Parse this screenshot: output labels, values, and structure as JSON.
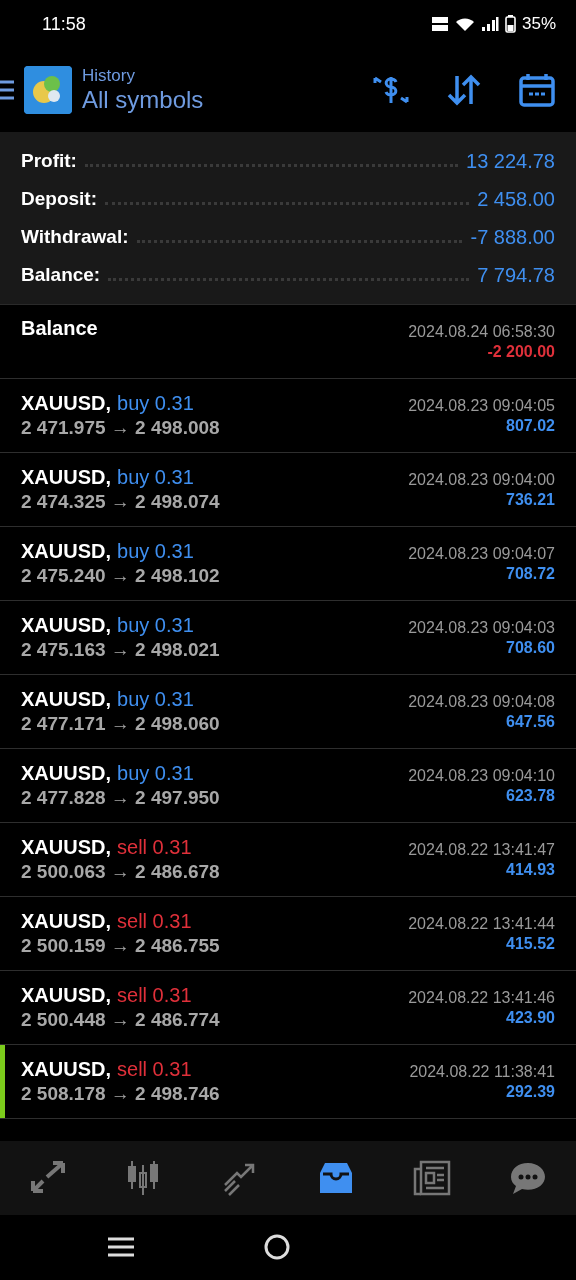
{
  "status_bar": {
    "time": "11:58",
    "battery": "35%"
  },
  "header": {
    "title": "History",
    "subtitle": "All symbols"
  },
  "summary": [
    {
      "label": "Profit:",
      "value": "13 224.78"
    },
    {
      "label": "Deposit:",
      "value": "2 458.00"
    },
    {
      "label": "Withdrawal:",
      "value": "-7 888.00"
    },
    {
      "label": "Balance:",
      "value": "7 794.78"
    }
  ],
  "rows": [
    {
      "kind": "balance",
      "title": "Balance",
      "time": "2024.08.24 06:58:30",
      "amount": "-2 200.00",
      "negative": true,
      "highlighted": false
    },
    {
      "kind": "trade",
      "symbol": "XAUUSD,",
      "side": "buy",
      "volume": "0.31",
      "prices": "2 471.975 → 2 498.008",
      "time": "2024.08.23 09:04:05",
      "amount": "807.02",
      "negative": false,
      "highlighted": false
    },
    {
      "kind": "trade",
      "symbol": "XAUUSD,",
      "side": "buy",
      "volume": "0.31",
      "prices": "2 474.325 → 2 498.074",
      "time": "2024.08.23 09:04:00",
      "amount": "736.21",
      "negative": false,
      "highlighted": false
    },
    {
      "kind": "trade",
      "symbol": "XAUUSD,",
      "side": "buy",
      "volume": "0.31",
      "prices": "2 475.240 → 2 498.102",
      "time": "2024.08.23 09:04:07",
      "amount": "708.72",
      "negative": false,
      "highlighted": false
    },
    {
      "kind": "trade",
      "symbol": "XAUUSD,",
      "side": "buy",
      "volume": "0.31",
      "prices": "2 475.163 → 2 498.021",
      "time": "2024.08.23 09:04:03",
      "amount": "708.60",
      "negative": false,
      "highlighted": false
    },
    {
      "kind": "trade",
      "symbol": "XAUUSD,",
      "side": "buy",
      "volume": "0.31",
      "prices": "2 477.171 → 2 498.060",
      "time": "2024.08.23 09:04:08",
      "amount": "647.56",
      "negative": false,
      "highlighted": false
    },
    {
      "kind": "trade",
      "symbol": "XAUUSD,",
      "side": "buy",
      "volume": "0.31",
      "prices": "2 477.828 → 2 497.950",
      "time": "2024.08.23 09:04:10",
      "amount": "623.78",
      "negative": false,
      "highlighted": false
    },
    {
      "kind": "trade",
      "symbol": "XAUUSD,",
      "side": "sell",
      "volume": "0.31",
      "prices": "2 500.063 → 2 486.678",
      "time": "2024.08.22 13:41:47",
      "amount": "414.93",
      "negative": false,
      "highlighted": false
    },
    {
      "kind": "trade",
      "symbol": "XAUUSD,",
      "side": "sell",
      "volume": "0.31",
      "prices": "2 500.159 → 2 486.755",
      "time": "2024.08.22 13:41:44",
      "amount": "415.52",
      "negative": false,
      "highlighted": false
    },
    {
      "kind": "trade",
      "symbol": "XAUUSD,",
      "side": "sell",
      "volume": "0.31",
      "prices": "2 500.448 → 2 486.774",
      "time": "2024.08.22 13:41:46",
      "amount": "423.90",
      "negative": false,
      "highlighted": false
    },
    {
      "kind": "trade",
      "symbol": "XAUUSD,",
      "side": "sell",
      "volume": "0.31",
      "prices": "2 508.178 → 2 498.746",
      "time": "2024.08.22 11:38:41",
      "amount": "292.39",
      "negative": false,
      "highlighted": true
    }
  ],
  "nav": [
    {
      "kind": "trade",
      "selected": false
    },
    {
      "kind": "quotes",
      "selected": false
    },
    {
      "kind": "chart",
      "selected": false
    },
    {
      "kind": "history",
      "selected": true
    },
    {
      "kind": "news",
      "selected": false
    },
    {
      "kind": "chat",
      "selected": false
    }
  ]
}
